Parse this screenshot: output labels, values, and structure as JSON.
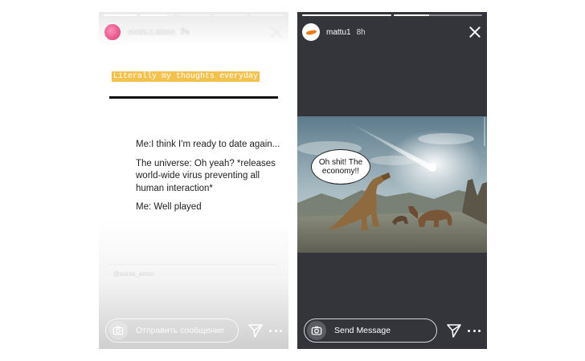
{
  "stories": [
    {
      "username": "sonia.x.ainos",
      "time": "7ч",
      "highlight_text": "Literally my thoughts everyday",
      "meme_lines": [
        "Me:I think I'm ready to date again...",
        "The universe: Oh yeah? *releases world-wide virus preventing all human interaction*",
        "Me: Well played"
      ],
      "watermark": "@sonia_ainos",
      "message_placeholder": "Отправить сообщение",
      "progress": [
        1.0,
        0.8,
        0.0,
        0.0,
        0.0
      ]
    },
    {
      "username": "mattu1",
      "time": "8h",
      "speech_bubble": "Oh shit! The economy!!",
      "message_placeholder": "Send Message",
      "progress": [
        1.0,
        0.4
      ]
    }
  ]
}
